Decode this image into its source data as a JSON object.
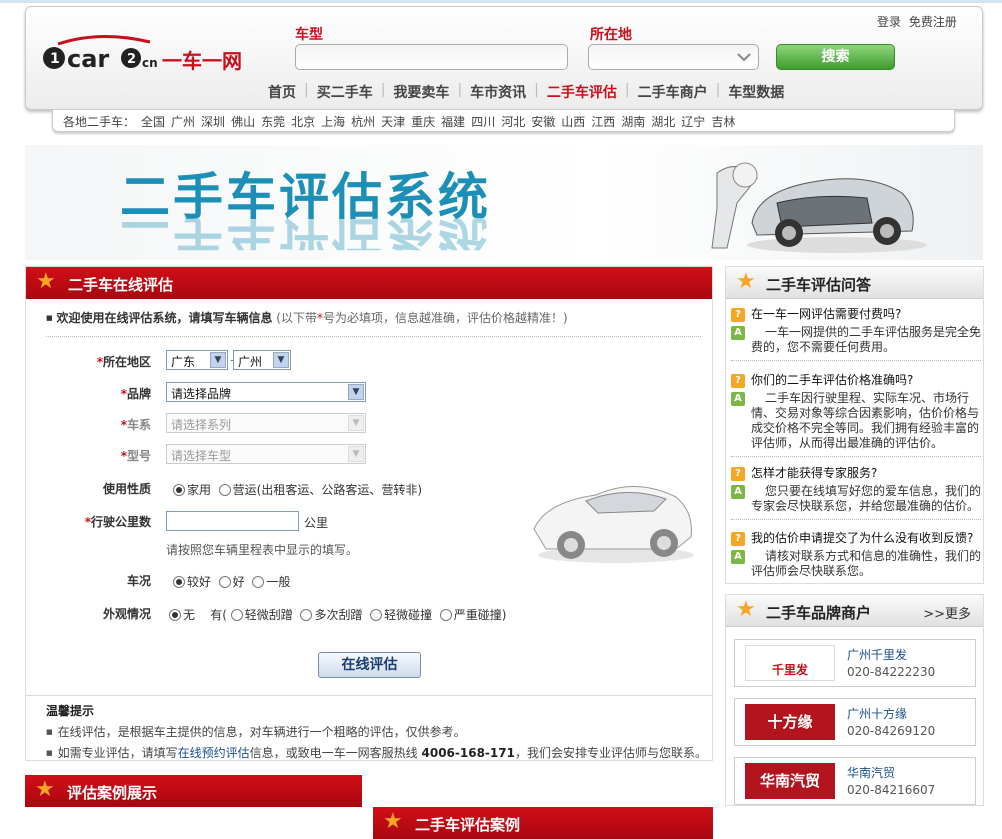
{
  "header": {
    "logo_text": "1car2cn 一车一网",
    "logo_brand": "1car",
    "logo_suffix": ".cn",
    "logo_cn": "一车一网",
    "login": "登录",
    "register": "免费注册",
    "search_label_model": "车型",
    "search_label_location": "所在地",
    "search_button": "搜索",
    "nav": [
      {
        "label": "首页",
        "active": false
      },
      {
        "label": "买二手车",
        "active": false
      },
      {
        "label": "我要卖车",
        "active": false
      },
      {
        "label": "车市资讯",
        "active": false
      },
      {
        "label": "二手车评估",
        "active": true
      },
      {
        "label": "二手车商户",
        "active": false
      },
      {
        "label": "车型数据",
        "active": false
      }
    ],
    "city_bar_label": "各地二手车：",
    "cities": [
      "全国",
      "广州",
      "深圳",
      "佛山",
      "东莞",
      "北京",
      "上海",
      "杭州",
      "天津",
      "重庆",
      "福建",
      "四川",
      "河北",
      "安徽",
      "山西",
      "江西",
      "湖南",
      "湖北",
      "辽宁",
      "吉林"
    ]
  },
  "banner": {
    "title": "二手车评估系统"
  },
  "eval_form": {
    "heading": "二手车在线评估",
    "welcome_bold": "欢迎使用在线评估系统，请填写车辆信息",
    "welcome_note_pre": "(以下带",
    "welcome_star": "*",
    "welcome_note_post": "号为必填项，信息越准确，评估价格越精准！)",
    "region_label": "所在地区",
    "province": "广东",
    "city": "广州",
    "brand_label": "品牌",
    "brand_value": "请选择品牌",
    "series_label": "车系",
    "series_value": "请选择系列",
    "model_label": "型号",
    "model_value": "请选择车型",
    "usage_label": "使用性质",
    "usage_options": [
      "家用",
      "营运(出租客运、公路客运、营转非)"
    ],
    "mileage_label": "行驶公里数",
    "mileage_unit": "公里",
    "mileage_hint": "请按照您车辆里程表中显示的填写。",
    "condition_label": "车况",
    "condition_options": [
      "较好",
      "好",
      "一般"
    ],
    "appearance_label": "外观情况",
    "appearance_none": "无",
    "appearance_has": "有(",
    "appearance_options": [
      "轻微刮蹭",
      "多次刮蹭",
      "轻微碰撞",
      "严重碰撞)"
    ],
    "submit": "在线评估",
    "tips_title": "温馨提示",
    "tip1": "在线评估，是根据车主提供的信息，对车辆进行一个粗略的评估，仅供参考。",
    "tip2_pre": "如需专业评估，请填写",
    "tip2_link": "在线预约评估",
    "tip2_mid": "信息，或致电一车一网客服热线",
    "tip2_phone": "4006-168-171",
    "tip2_post": "，我们会安排专业评估师与您联系。"
  },
  "qa": {
    "heading": "二手车评估问答",
    "items": [
      {
        "q": "在一车一网评估需要付费吗?",
        "a": "一车一网提供的二手车评估服务是完全免费的，您不需要任何费用。"
      },
      {
        "q": "你们的二手车评估价格准确吗?",
        "a": "二手车因行驶里程、实际车况、市场行情、交易对象等综合因素影响，估价价格与成交价格不完全等同。我们拥有经验丰富的评估师，从而得出最准确的评估价。"
      },
      {
        "q": "怎样才能获得专家服务?",
        "a": "您只要在线填写好您的爱车信息，我们的专家会尽快联系您，并给您最准确的估价。"
      },
      {
        "q": "我的估价申请提交了为什么没有收到反馈?",
        "a": "请核对联系方式和信息的准确性，我们的评估师会尽快联系您。"
      }
    ]
  },
  "merchants": {
    "heading": "二手车品牌商户",
    "more": ">>更多",
    "items": [
      {
        "logo": "千里发",
        "name": "广州千里发",
        "tel": "020-84222230"
      },
      {
        "logo": "十方缘",
        "name": "广州十方缘",
        "tel": "020-84269120"
      },
      {
        "logo": "华南汽贸",
        "name": "华南汽贸",
        "tel": "020-84216607"
      }
    ]
  },
  "bottom": {
    "cases_show": "评估案例展示",
    "cases": "二手车评估案例"
  },
  "colors": {
    "brand_red": "#c8101c",
    "search_green": "#3e9c2e",
    "title_blue": "#1c8fb6"
  }
}
